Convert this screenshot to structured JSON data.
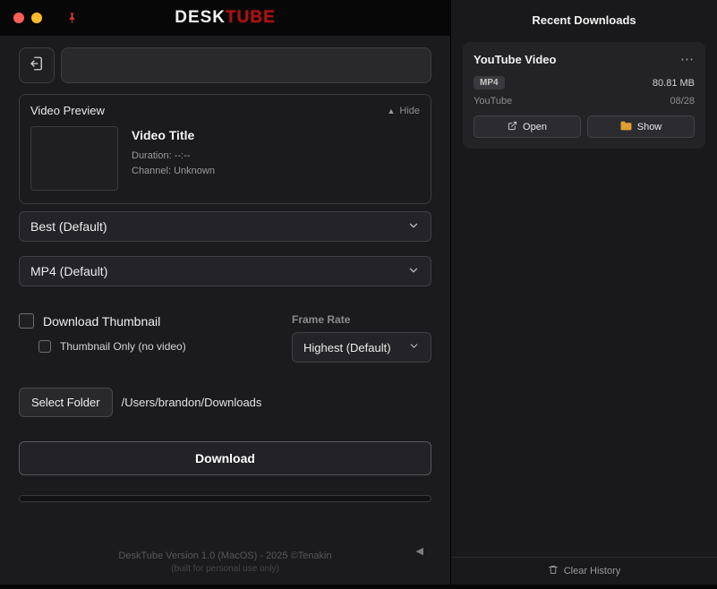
{
  "titlebar": {
    "logo_desk": "DESK",
    "logo_tube": "TUBE"
  },
  "left": {
    "url_input": {
      "value": "",
      "placeholder": ""
    },
    "preview": {
      "section_label": "Video Preview",
      "hide_icon": "▲",
      "hide_label": "Hide",
      "title": "Video Title",
      "duration": "Duration: --:--",
      "channel": "Channel: Unknown"
    },
    "quality_dropdown": "Best (Default)",
    "format_dropdown": "MP4 (Default)",
    "download_thumbnail_label": "Download Thumbnail",
    "download_thumbnail_checked": false,
    "thumbnail_only_label": "Thumbnail Only (no video)",
    "thumbnail_only_checked": false,
    "frame_rate_label": "Frame Rate",
    "frame_rate_dropdown": "Highest (Default)",
    "select_folder_button": "Select Folder",
    "folder_path": "/Users/brandon/Downloads",
    "download_button": "Download",
    "progress_percent": 0,
    "footer_line1": "DeskTube Version 1.0 (MacOS) - 2025 ©Tenakin",
    "footer_line2": "(built for personal use only)",
    "collapse_arrow": "◀"
  },
  "right": {
    "header": "Recent Downloads",
    "downloads": [
      {
        "title": "YouTube Video",
        "menu": "⋯",
        "format_badge": "MP4",
        "size": "80.81 MB",
        "source": "YouTube",
        "date": "08/28",
        "open_label": "Open",
        "show_label": "Show"
      }
    ],
    "clear_history": "Clear History"
  }
}
